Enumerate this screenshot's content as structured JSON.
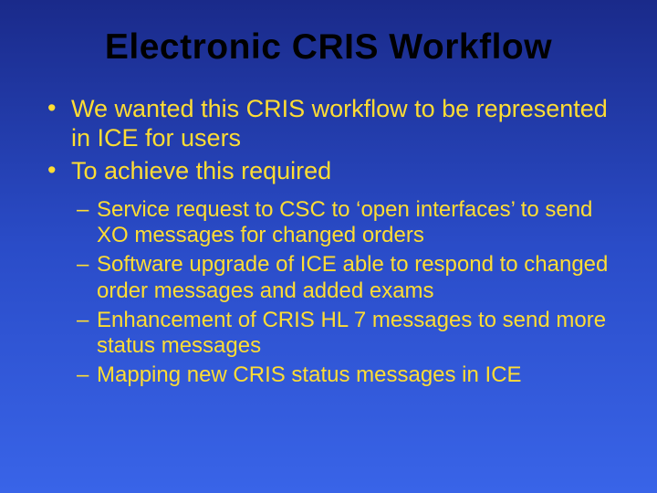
{
  "title": "Electronic CRIS Workflow",
  "bullets": {
    "b1": "We wanted this CRIS workflow to be represented in ICE for users",
    "b2": "To achieve this required"
  },
  "sub_bullets": {
    "s1": "Service request to CSC to ‘open interfaces’ to send XO messages for changed orders",
    "s2": "Software upgrade of ICE able to respond to changed order messages and added exams",
    "s3": "Enhancement of CRIS HL 7 messages to send more status messages",
    "s4": "Mapping new CRIS status messages in ICE"
  }
}
